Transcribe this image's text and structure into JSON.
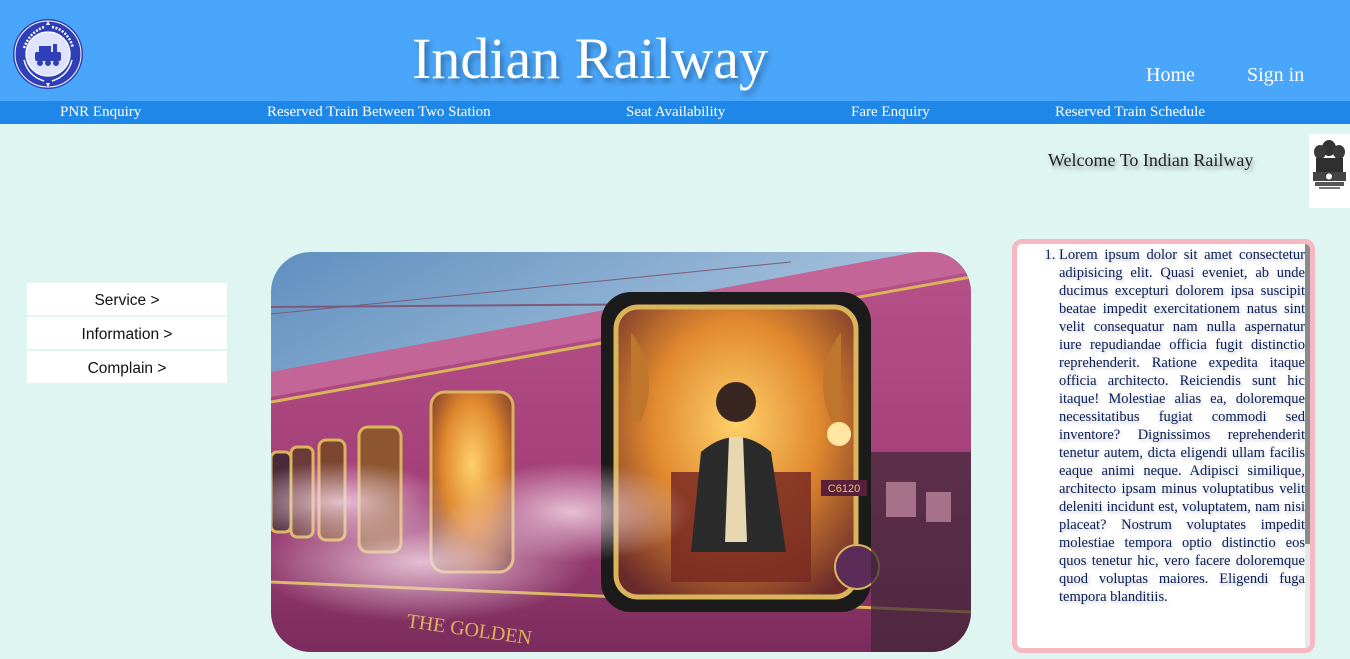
{
  "header": {
    "title": "Indian Railway",
    "logo_icon": "indian-railways-logo-icon",
    "home_label": "Home",
    "signin_label": "Sign in",
    "background": "#4aa6fb"
  },
  "menu": {
    "background": "#1e87e8",
    "items": [
      {
        "label": "PNR Enquiry"
      },
      {
        "label": "Reserved Train Between Two Station"
      },
      {
        "label": "Seat Availability"
      },
      {
        "label": "Fare Enquiry"
      },
      {
        "label": "Reserved Train Schedule"
      }
    ]
  },
  "welcome": {
    "text": "Welcome To Indian Railway",
    "emblem_icon": "national-emblem-icon",
    "emblem_caption": "सत्यमेव जयते"
  },
  "side_menu": {
    "items": [
      {
        "label": "Service >"
      },
      {
        "label": "Information >"
      },
      {
        "label": "Complain >"
      }
    ]
  },
  "hero": {
    "image": "luxury-train-coach-image",
    "coach_number": "C6120",
    "coach_text": "THE GOLDEN"
  },
  "info_box": {
    "border_color": "#f7b8c4",
    "items": [
      "Lorem ipsum dolor sit amet consectetur adipisicing elit. Quasi eveniet, ab unde ducimus excepturi dolorem ipsa suscipit beatae impedit exercitationem natus sint velit consequatur nam nulla aspernatur iure repudiandae officia fugit distinctio reprehenderit. Ratione expedita itaque officia architecto. Reiciendis sunt hic itaque! Molestiae alias ea, doloremque necessitatibus fugiat commodi sed inventore? Dignissimos reprehenderit tenetur autem, dicta eligendi ullam facilis eaque animi neque. Adipisci similique, architecto ipsam minus voluptatibus velit deleniti incidunt est, voluptatem, nam nisi placeat? Nostrum voluptates impedit molestiae tempora optio distinctio eos quos tenetur hic, vero facere doloremque quod voluptas maiores. Eligendi fuga tempora blanditiis."
    ]
  }
}
